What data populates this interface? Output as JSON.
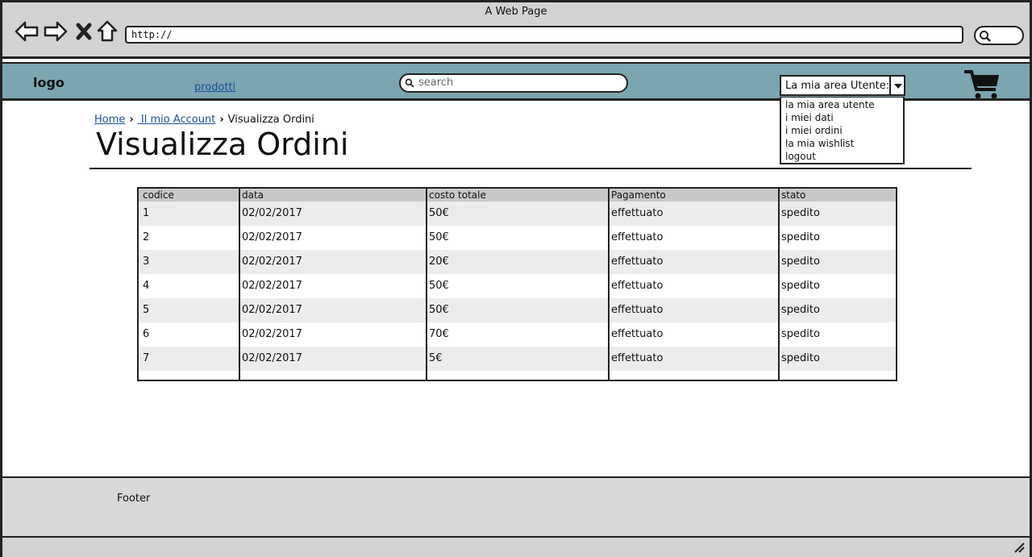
{
  "window": {
    "title": "A Web Page",
    "url": "http://"
  },
  "header": {
    "logo": "logo",
    "nav_link": "prodotti",
    "search_placeholder": "search",
    "area_select": "La mia area Utente:"
  },
  "dropdown": {
    "items": [
      "la mia area utente",
      "i miei dati",
      "i miei ordini",
      "la mia wishlist",
      "logout"
    ]
  },
  "breadcrumb": {
    "home": "Home",
    "account": " Il mio Account",
    "current": "Visualizza Ordini"
  },
  "page": {
    "title": "Visualizza Ordini"
  },
  "table": {
    "columns": [
      "codice",
      "data",
      "costo totale",
      "Pagamento",
      "stato"
    ],
    "rows": [
      [
        "1",
        "02/02/2017",
        "50€",
        "effettuato",
        "spedito"
      ],
      [
        "2",
        "02/02/2017",
        "50€",
        "effettuato",
        "spedito"
      ],
      [
        "3",
        "02/02/2017",
        "20€",
        "effettuato",
        "spedito"
      ],
      [
        "4",
        "02/02/2017",
        "50€",
        "effettuato",
        "spedito"
      ],
      [
        "5",
        "02/02/2017",
        "50€",
        "effettuato",
        "spedito"
      ],
      [
        "6",
        "02/02/2017",
        "70€",
        "effettuato",
        "spedito"
      ],
      [
        "7",
        "02/02/2017",
        "5€",
        "effettuato",
        "spedito"
      ]
    ]
  },
  "footer": {
    "text": "Footer"
  },
  "colors": {
    "header_bg": "#7ba5af",
    "link": "#1a4fa0",
    "chrome": "#d2d2d2"
  }
}
